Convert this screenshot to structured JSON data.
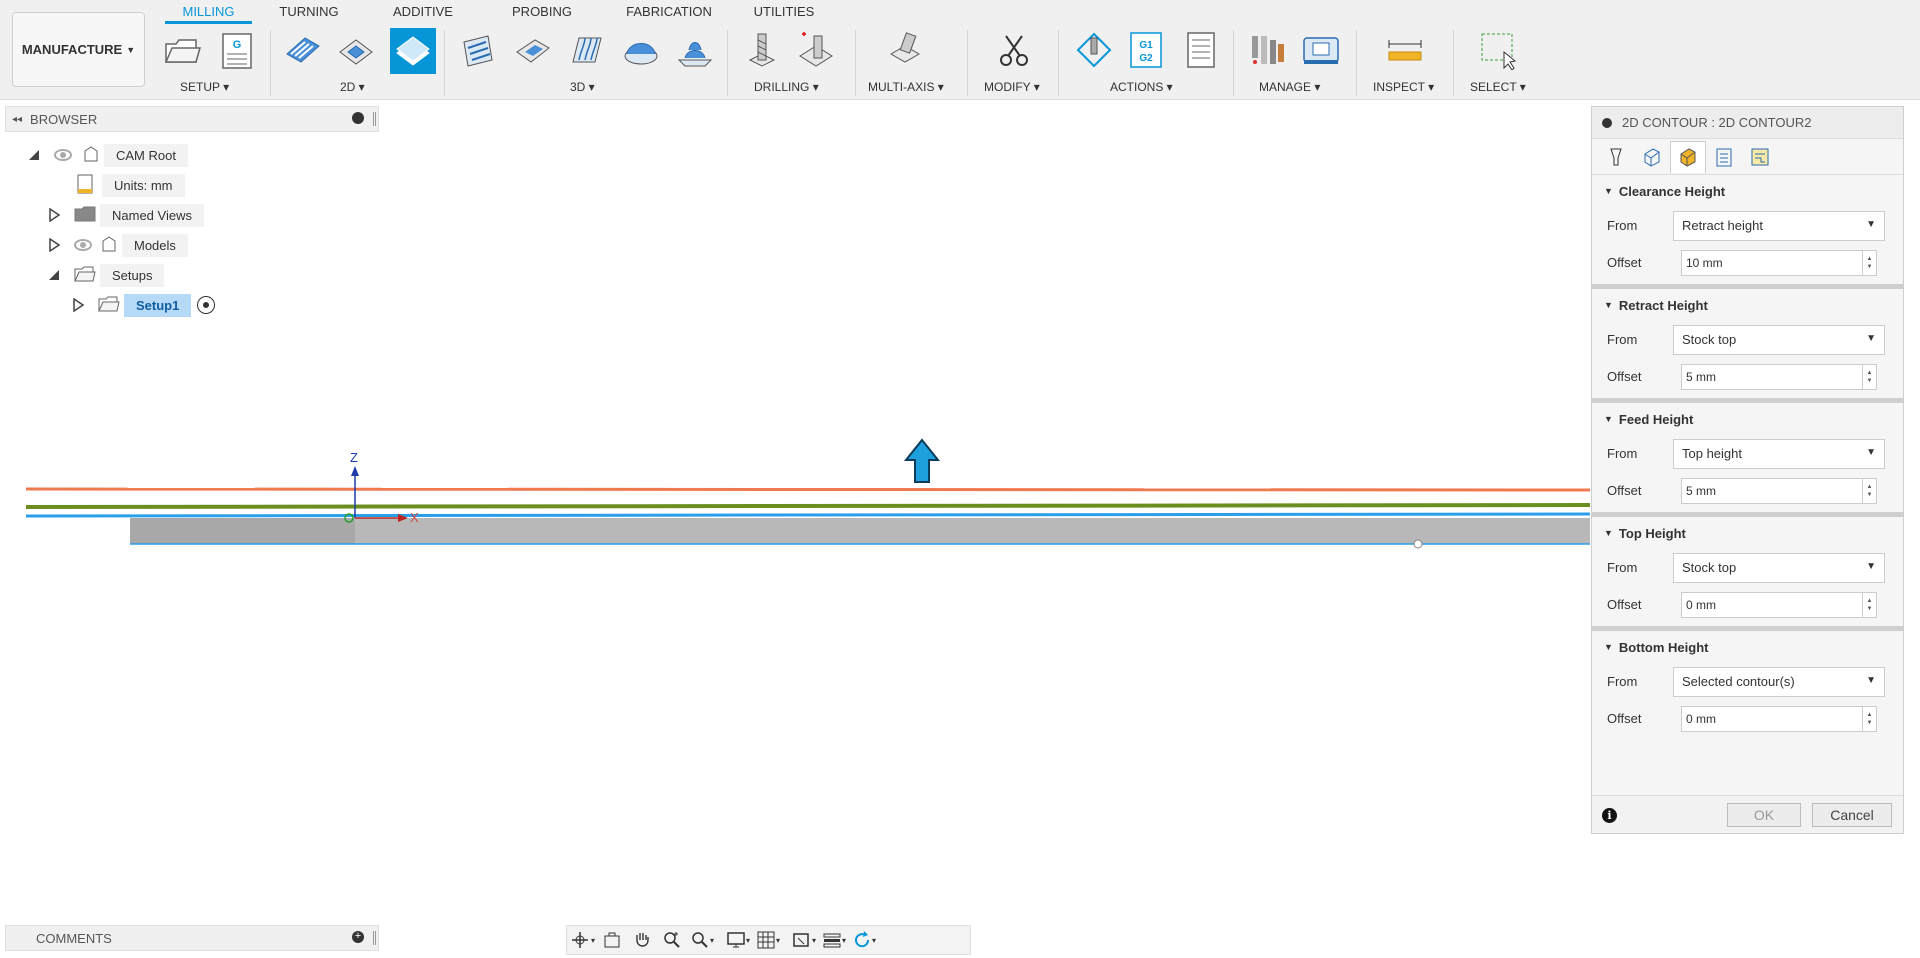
{
  "workspace_label": "MANUFACTURE",
  "tabs": [
    "MILLING",
    "TURNING",
    "ADDITIVE",
    "PROBING",
    "FABRICATION",
    "UTILITIES"
  ],
  "groups": {
    "setup": "SETUP",
    "two_d": "2D",
    "three_d": "3D",
    "drilling": "DRILLING",
    "multi_axis": "MULTI-AXIS",
    "modify": "MODIFY",
    "actions": "ACTIONS",
    "manage": "MANAGE",
    "inspect": "INSPECT",
    "select": "SELECT"
  },
  "toolbar_icon_text": {
    "g_label": "G",
    "g1g2_label": "G1 G2"
  },
  "browser": {
    "title": "BROWSER",
    "items": {
      "cam_root": "CAM Root",
      "units": "Units: mm",
      "named_views": "Named Views",
      "models": "Models",
      "setups": "Setups",
      "setup1": "Setup1"
    }
  },
  "viewport": {
    "axis_z": "Z",
    "axis_x": "X"
  },
  "panel": {
    "title": "2D CONTOUR : 2D CONTOUR2",
    "from_label": "From",
    "offset_label": "Offset",
    "sections": {
      "clearance": {
        "title": "Clearance Height",
        "from": "Retract height",
        "offset": "10 mm"
      },
      "retract": {
        "title": "Retract Height",
        "from": "Stock top",
        "offset": "5 mm"
      },
      "feed": {
        "title": "Feed Height",
        "from": "Top height",
        "offset": "5 mm"
      },
      "top": {
        "title": "Top Height",
        "from": "Stock top",
        "offset": "0 mm"
      },
      "bottom": {
        "title": "Bottom Height",
        "from": "Selected contour(s)",
        "offset": "0 mm"
      }
    },
    "ok": "OK",
    "cancel": "Cancel"
  },
  "comments": {
    "title": "COMMENTS"
  },
  "colors": {
    "accent": "#0696d7",
    "clearance_line": "#f07a4f",
    "retract_line": "#6a8f1f",
    "feed_line": "#2a9ee8",
    "stock": "#b5b5b5"
  }
}
